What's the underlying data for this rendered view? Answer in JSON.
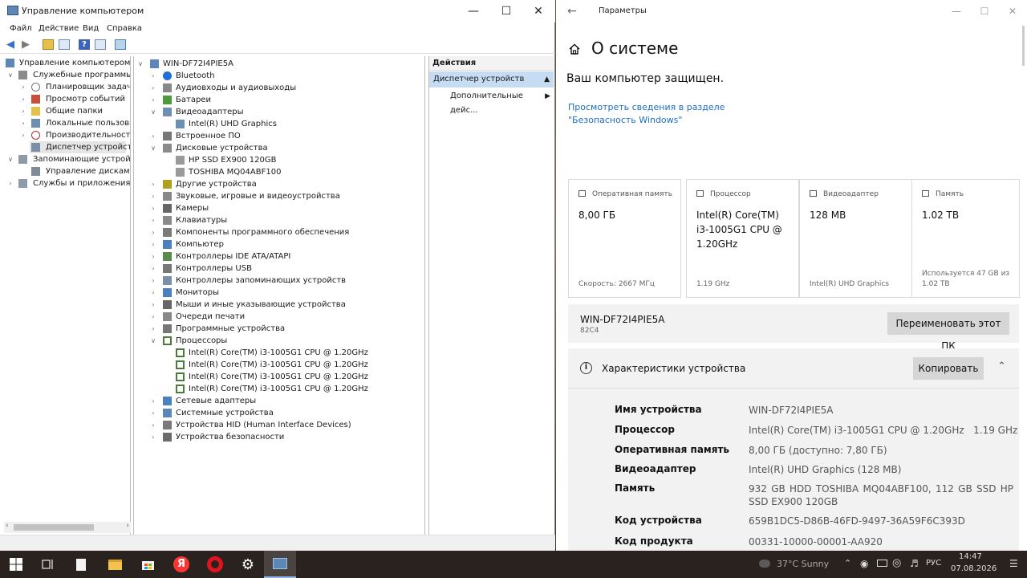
{
  "cm": {
    "title": "Управление компьютером",
    "menu": [
      "Файл",
      "Действие",
      "Вид",
      "Справка"
    ],
    "left_tree": [
      {
        "label": "Управление компьютером (лс",
        "icon": "computer-management-icon"
      },
      {
        "label": "Служебные программы",
        "icon": "tools-icon"
      },
      {
        "label": "Планировщик задач",
        "icon": "clock-icon"
      },
      {
        "label": "Просмотр событий",
        "icon": "event-viewer-icon"
      },
      {
        "label": "Общие папки",
        "icon": "shared-folder-icon"
      },
      {
        "label": "Локальные пользовате",
        "icon": "users-icon"
      },
      {
        "label": "Производительность",
        "icon": "performance-icon"
      },
      {
        "label": "Диспетчер устройств",
        "icon": "device-manager-icon"
      },
      {
        "label": "Запоминающие устройств",
        "icon": "storage-icon"
      },
      {
        "label": "Управление дисками",
        "icon": "disk-management-icon"
      },
      {
        "label": "Службы и приложения",
        "icon": "services-icon"
      }
    ],
    "device_tree": [
      {
        "label": "WIN-DF72I4PIE5A",
        "icon": "computer-icon"
      },
      {
        "label": "Bluetooth",
        "icon": "bluetooth-icon"
      },
      {
        "label": "Аудиовходы и аудиовыходы",
        "icon": "audio-icon"
      },
      {
        "label": "Батареи",
        "icon": "battery-icon"
      },
      {
        "label": "Видеоадаптеры",
        "icon": "display-adapter-icon"
      },
      {
        "label": "Intel(R) UHD Graphics",
        "icon": "display-adapter-icon"
      },
      {
        "label": "Встроенное ПО",
        "icon": "firmware-icon"
      },
      {
        "label": "Дисковые устройства",
        "icon": "disk-drive-icon"
      },
      {
        "label": "HP SSD EX900 120GB",
        "icon": "disk-drive-icon"
      },
      {
        "label": "TOSHIBA MQ04ABF100",
        "icon": "disk-drive-icon"
      },
      {
        "label": "Другие устройства",
        "icon": "unknown-device-icon"
      },
      {
        "label": "Звуковые, игровые и видеоустройства",
        "icon": "sound-icon"
      },
      {
        "label": "Камеры",
        "icon": "camera-icon"
      },
      {
        "label": "Клавиатуры",
        "icon": "keyboard-icon"
      },
      {
        "label": "Компоненты программного обеспечения",
        "icon": "software-component-icon"
      },
      {
        "label": "Компьютер",
        "icon": "monitor-icon"
      },
      {
        "label": "Контроллеры IDE ATA/ATAPI",
        "icon": "ide-controller-icon"
      },
      {
        "label": "Контроллеры USB",
        "icon": "usb-icon"
      },
      {
        "label": "Контроллеры запоминающих устройств",
        "icon": "storage-controller-icon"
      },
      {
        "label": "Мониторы",
        "icon": "monitor-icon"
      },
      {
        "label": "Мыши и иные указывающие устройства",
        "icon": "mouse-icon"
      },
      {
        "label": "Очереди печати",
        "icon": "printer-icon"
      },
      {
        "label": "Программные устройства",
        "icon": "software-device-icon"
      },
      {
        "label": "Процессоры",
        "icon": "processor-icon"
      },
      {
        "label": "Intel(R) Core(TM) i3-1005G1 CPU @ 1.20GHz",
        "icon": "processor-icon"
      },
      {
        "label": "Intel(R) Core(TM) i3-1005G1 CPU @ 1.20GHz",
        "icon": "processor-icon"
      },
      {
        "label": "Intel(R) Core(TM) i3-1005G1 CPU @ 1.20GHz",
        "icon": "processor-icon"
      },
      {
        "label": "Intel(R) Core(TM) i3-1005G1 CPU @ 1.20GHz",
        "icon": "processor-icon"
      },
      {
        "label": "Сетевые адаптеры",
        "icon": "network-adapter-icon"
      },
      {
        "label": "Системные устройства",
        "icon": "system-device-icon"
      },
      {
        "label": "Устройства HID (Human Interface Devices)",
        "icon": "hid-icon"
      },
      {
        "label": "Устройства безопасности",
        "icon": "security-device-icon"
      }
    ],
    "actions": {
      "header": "Действия",
      "selected": "Диспетчер устройств",
      "more": "Дополнительные дейс..."
    }
  },
  "settings": {
    "window_title": "Параметры",
    "page_title": "О системе",
    "protected": "Ваш компьютер защищен.",
    "security_link": "Просмотреть сведения в разделе \"Безопасность Windows\"",
    "tiles": [
      {
        "header": "Оперативная память",
        "value": "8,00 ГБ",
        "footer": "Скорость: 2667 МГц",
        "icon": "memory-icon"
      },
      {
        "header": "Процессор",
        "value": "Intel(R) Core(TM) i3-1005G1 CPU @ 1.20GHz",
        "footer": "1.19 GHz",
        "icon": "cpu-icon"
      },
      {
        "header": "Видеоадаптер",
        "value": "128 MB",
        "footer": "Intel(R) UHD Graphics",
        "icon": "gpu-icon"
      },
      {
        "header": "Память",
        "value": "1.02 TB",
        "footer": "Используется 47 GB из 1.02 TB",
        "icon": "storage-icon"
      }
    ],
    "pc_name": "WIN-DF72I4PIE5A",
    "pc_model": "82C4",
    "rename_button": "Переименовать этот ПК",
    "specs_title": "Характеристики устройства",
    "copy_button": "Копировать",
    "specs": [
      {
        "key": "Имя устройства",
        "value": "WIN-DF72I4PIE5A"
      },
      {
        "key": "Процессор",
        "value": "Intel(R) Core(TM) i3-1005G1 CPU @ 1.20GHz   1.19 GHz"
      },
      {
        "key": "Оперативная память",
        "value": "8,00 ГБ (доступно: 7,80 ГБ)"
      },
      {
        "key": "Видеоадаптер",
        "value": "Intel(R) UHD Graphics (128 MB)"
      },
      {
        "key": "Память",
        "value": "932 GB HDD TOSHIBA MQ04ABF100, 112 GB SSD HP SSD EX900 120GB"
      },
      {
        "key": "Код устройства",
        "value": "659B1DC5-D86B-46FD-9497-36A59F6C393D"
      },
      {
        "key": "Код продукта",
        "value": "00331-10000-00001-AA920"
      }
    ]
  },
  "taskbar": {
    "weather": "37°C  Sunny",
    "language": "РУС",
    "time": "14:47",
    "date": "07.08.2026"
  },
  "colors": {
    "link": "#1a6fc6",
    "selection": "#c6dcf2",
    "taskbar": "#2a221e"
  }
}
